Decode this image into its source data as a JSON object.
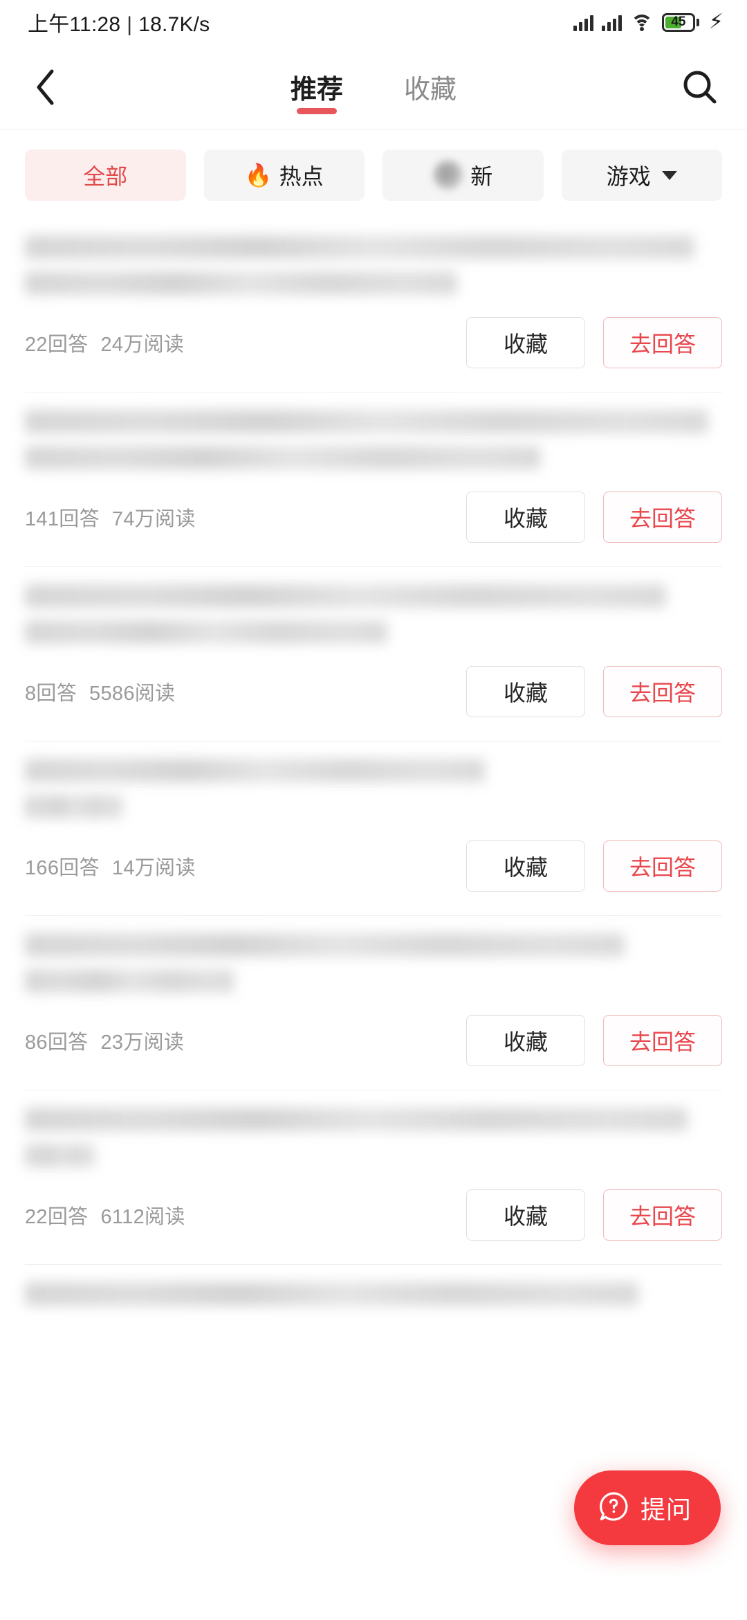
{
  "status_bar": {
    "time": "上午11:28",
    "separator": "|",
    "network_speed": "18.7K/s",
    "battery_percent": "45",
    "icons": [
      "signal-icon",
      "signal-icon",
      "wifi-icon",
      "battery-icon",
      "charging-bolt-icon"
    ]
  },
  "nav": {
    "back_icon": "back-chevron-icon",
    "search_icon": "search-icon",
    "tabs": [
      {
        "label": "推荐",
        "active": true
      },
      {
        "label": "收藏",
        "active": false
      }
    ]
  },
  "filters": [
    {
      "label": "全部",
      "selected": true,
      "icon": null
    },
    {
      "label": "热点",
      "selected": false,
      "icon": "flame-icon"
    },
    {
      "label": "新",
      "selected": false,
      "icon": "blurred-icon"
    },
    {
      "label": "游戏",
      "selected": false,
      "icon": "chevron-down-icon"
    }
  ],
  "list": {
    "answer_suffix": "回答",
    "read_suffix": "阅读",
    "favorite_label": "收藏",
    "answer_label": "去回答",
    "items": [
      {
        "title_lines": 2,
        "answers": "22回答",
        "reads": "24万阅读"
      },
      {
        "title_lines": 2,
        "answers": "141回答",
        "reads": "74万阅读"
      },
      {
        "title_lines": 2,
        "answers": "8回答",
        "reads": "5586阅读"
      },
      {
        "title_lines": 1,
        "answers": "166回答",
        "reads": "14万阅读"
      },
      {
        "title_lines": 2,
        "answers": "86回答",
        "reads": "23万阅读"
      },
      {
        "title_lines": 2,
        "answers": "22回答",
        "reads": "6112阅读"
      }
    ]
  },
  "fab": {
    "label": "提问",
    "icon": "question-bubble-icon"
  },
  "colors": {
    "accent_red": "#e8474d",
    "fab_red": "#f4393f",
    "chip_selected_bg": "#fdeeee",
    "chip_bg": "#f5f5f5",
    "muted_text": "#9a9a9a"
  }
}
